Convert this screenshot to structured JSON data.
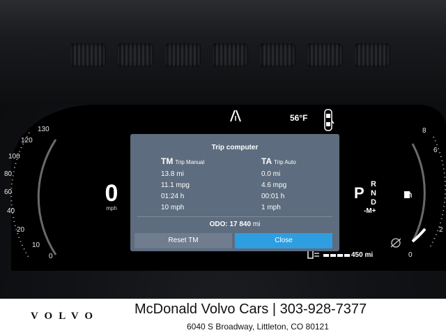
{
  "cluster": {
    "temperature": "56°F",
    "speed": "0",
    "speed_unit": "mph",
    "speed_scale": [
      "0",
      "10",
      "20",
      "40",
      "60",
      "80",
      "100",
      "120",
      "130"
    ],
    "rpm_scale": [
      "0",
      "2",
      "6",
      "8"
    ],
    "gear": {
      "current": "P",
      "list": [
        "R",
        "N",
        "D"
      ],
      "manual": "-M+"
    },
    "range": "450 mi"
  },
  "trip_computer": {
    "title": "Trip computer",
    "tm": {
      "code": "TM",
      "label": "Trip Manual",
      "rows": [
        "13.8 mi",
        "11.1 mpg",
        "01:24 h",
        "10 mph"
      ]
    },
    "ta": {
      "code": "TA",
      "label": "Trip Auto",
      "rows": [
        "0.0 mi",
        "4.6 mpg",
        "00:01 h",
        "1 mph"
      ]
    },
    "odo_label": "ODO:",
    "odo_value": "17 840",
    "odo_unit": "mi",
    "buttons": {
      "reset": "Reset TM",
      "close": "Close"
    }
  },
  "footer": {
    "brand": "VOLVO",
    "dealer_line": "McDonald Volvo Cars | 303-928-7377",
    "address": "6040 S Broadway, Littleton, CO 80121"
  },
  "icons": [
    "lane-assist-icon",
    "car-door-icon",
    "fuel-pump-icon",
    "range-icon",
    "driver-assist-icon"
  ]
}
